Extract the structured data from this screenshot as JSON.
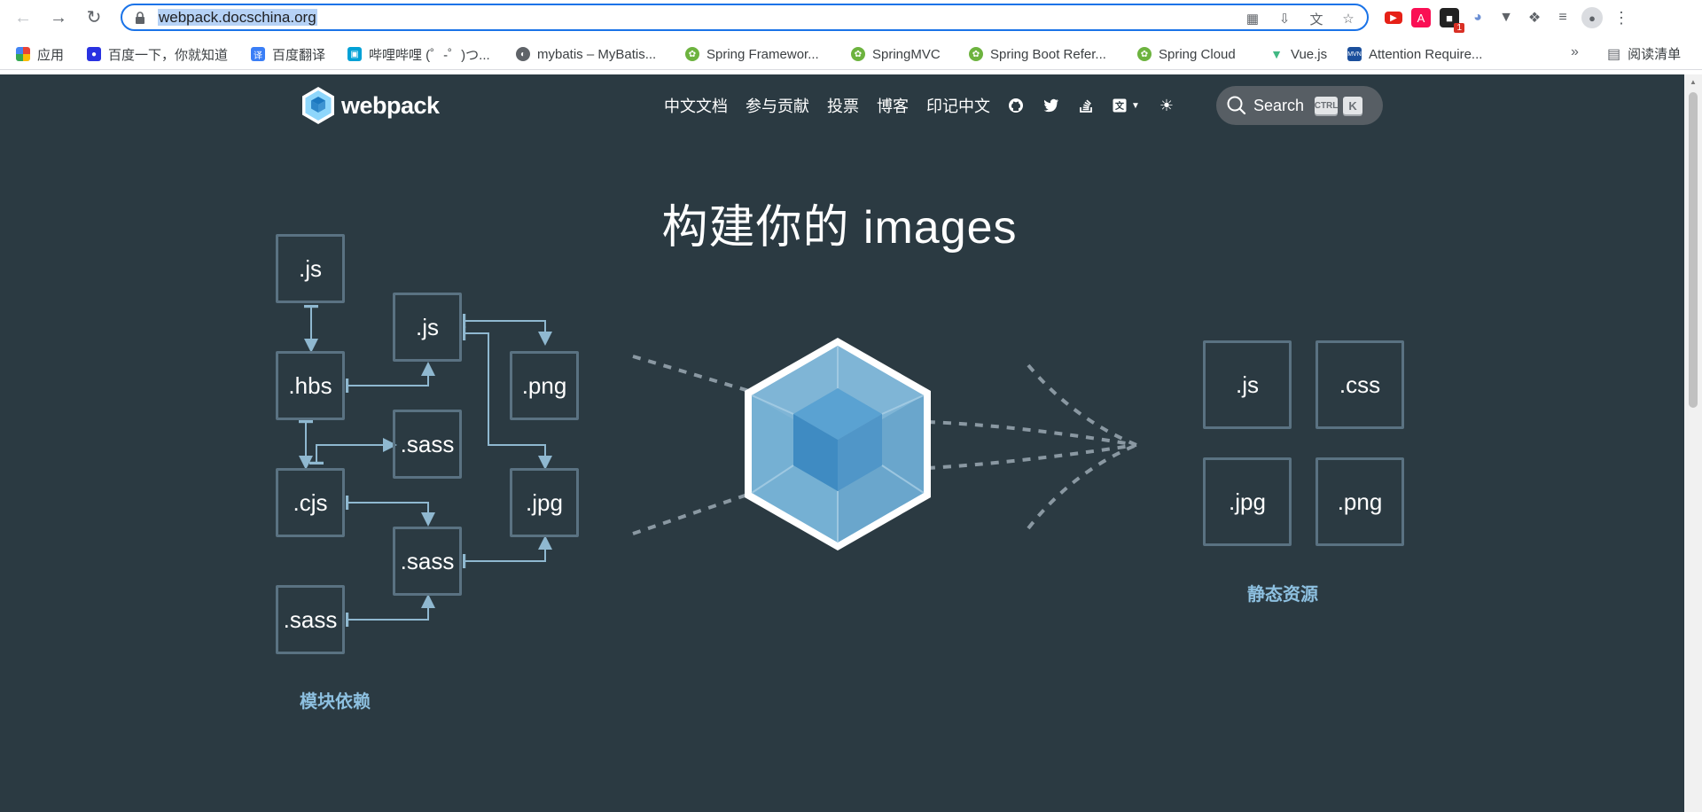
{
  "browser": {
    "url": "webpack.docschina.org",
    "bookmarks": [
      {
        "label": "应用",
        "icon": "apps-grid-icon"
      },
      {
        "label": "百度一下，你就知道",
        "icon": "baidu-paw-icon"
      },
      {
        "label": "百度翻译",
        "icon": "baidu-translate-icon"
      },
      {
        "label": "哔哩哔哩 (゜-゜)つ...",
        "icon": "bilibili-icon"
      },
      {
        "label": "mybatis – MyBatis...",
        "icon": "globe-icon"
      },
      {
        "label": "Spring Framewor...",
        "icon": "spring-leaf-icon"
      },
      {
        "label": "SpringMVC",
        "icon": "spring-leaf-icon"
      },
      {
        "label": "Spring Boot Refer...",
        "icon": "spring-leaf-icon"
      },
      {
        "label": "Spring Cloud",
        "icon": "spring-leaf-icon"
      },
      {
        "label": "Vue.js",
        "icon": "vue-icon"
      },
      {
        "label": "Attention Require...",
        "icon": "mvn-icon"
      }
    ],
    "more_label": "»",
    "reading_list_label": "阅读清单",
    "extension_badge": "1"
  },
  "site": {
    "logo_text": "webpack",
    "nav": [
      "中文文档",
      "参与贡献",
      "投票",
      "博客",
      "印记中文"
    ],
    "search_label": "Search",
    "search_keys": [
      "CTRL",
      "K"
    ]
  },
  "hero": {
    "title": "构建你的 images",
    "modules": [
      ".js",
      ".js",
      ".png",
      ".hbs",
      ".sass",
      ".cjs",
      ".jpg",
      ".sass",
      ".sass"
    ],
    "modules_caption": "模块依赖",
    "assets": [
      ".js",
      ".css",
      ".jpg",
      ".png"
    ],
    "assets_caption": "静态资源"
  },
  "colors": {
    "page_bg": "#2b3a42",
    "box_border": "#5a7282",
    "arrow": "#8fb8d0",
    "caption": "#8dc0e0",
    "cube_light": "#8ed6fb",
    "cube_dark": "#1c78c0"
  }
}
